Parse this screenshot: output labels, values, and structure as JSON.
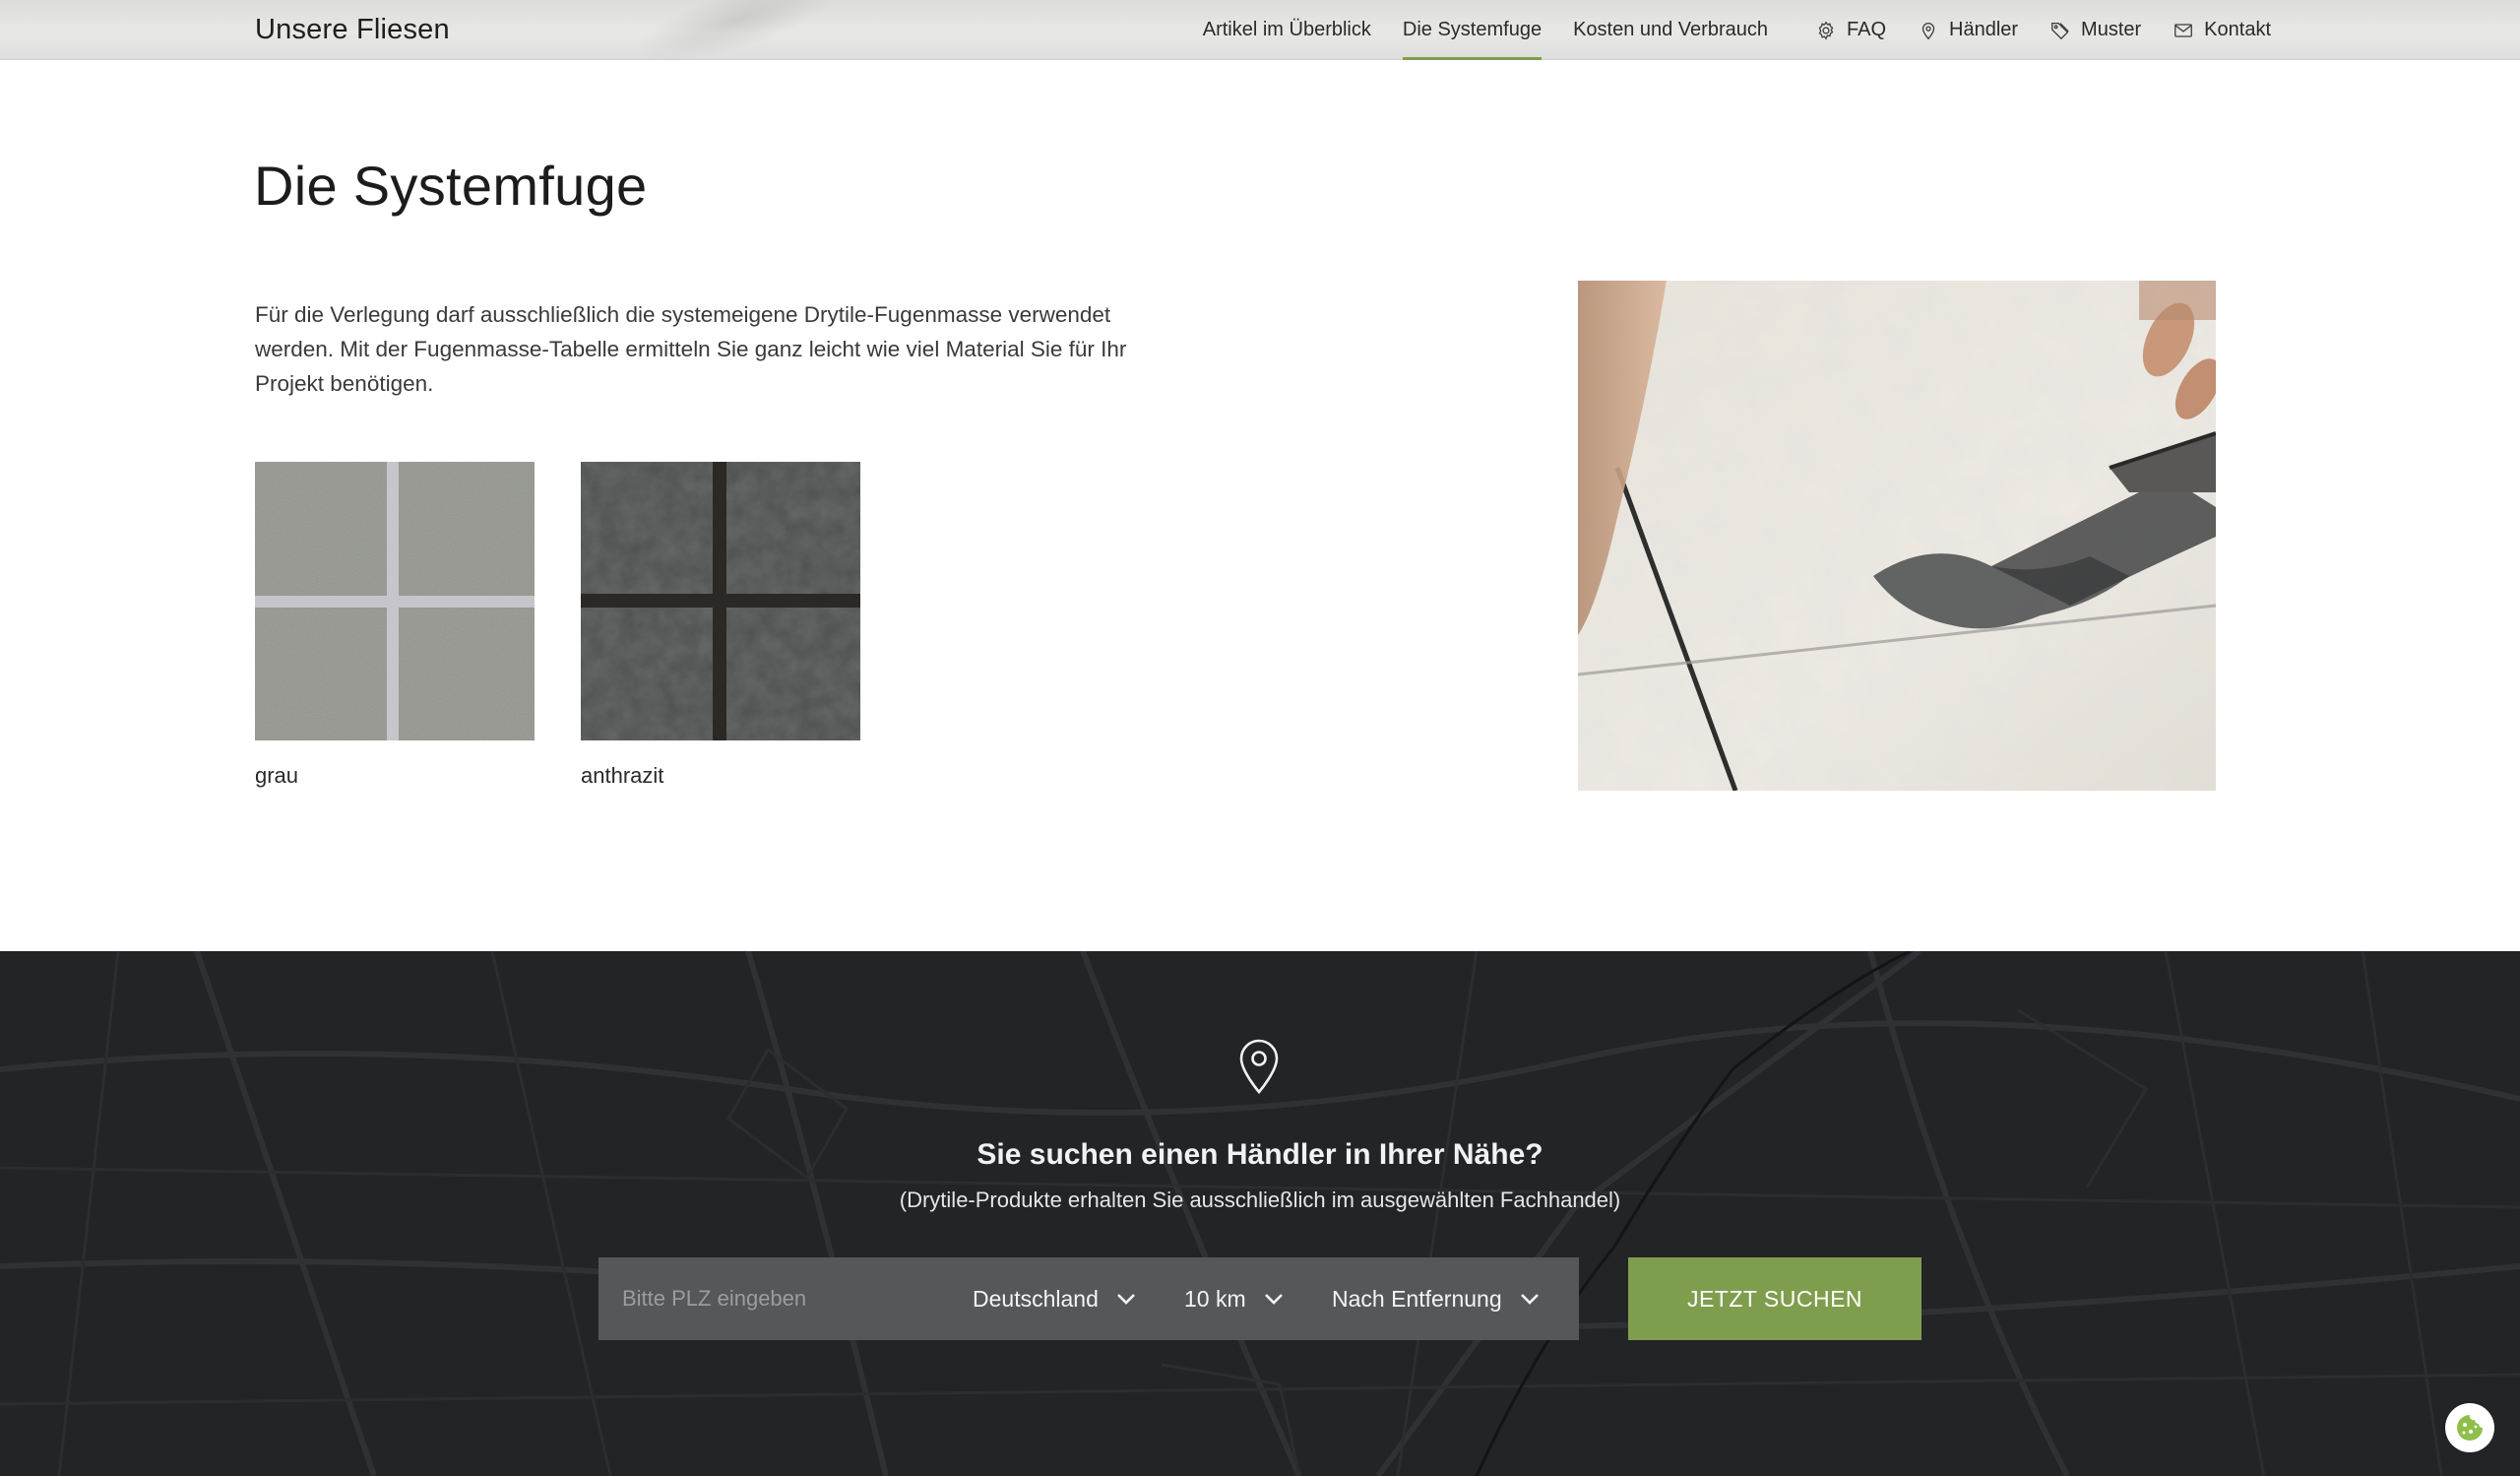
{
  "header": {
    "brand": "Unsere Fliesen",
    "nav": [
      {
        "label": "Artikel im Überblick",
        "icon": null,
        "active": false
      },
      {
        "label": "Die Systemfuge",
        "icon": null,
        "active": true
      },
      {
        "label": "Kosten und Verbrauch",
        "icon": null,
        "active": false
      },
      {
        "label": "FAQ",
        "icon": "gear-icon",
        "active": false
      },
      {
        "label": "Händler",
        "icon": "map-pin-icon",
        "active": false
      },
      {
        "label": "Muster",
        "icon": "tag-icon",
        "active": false
      },
      {
        "label": "Kontakt",
        "icon": "envelope-icon",
        "active": false
      }
    ]
  },
  "main": {
    "title": "Die Systemfuge",
    "intro": "Für die Verlegung darf ausschließlich die systemeigene Drytile-Fugenmasse verwendet werden. Mit der Fugenmasse-Tabelle ermitteln Sie ganz leicht wie viel Material Sie für Ihr Projekt benötigen.",
    "swatches": [
      {
        "label": "grau",
        "tile_color": "#8f918a",
        "grout_color": "#c9c8cf"
      },
      {
        "label": "anthrazit",
        "tile_color": "#4a4c4c",
        "grout_color": "#2a2826"
      }
    ]
  },
  "dealer": {
    "title": "Sie suchen einen Händler in Ihrer Nähe?",
    "subtitle": "(Drytile-Produkte erhalten Sie ausschließlich im ausgewählten Fachhandel)",
    "plz_placeholder": "Bitte PLZ eingeben",
    "country": "Deutschland",
    "radius": "10 km",
    "sort": "Nach Entfernung",
    "button": "JETZT SUCHEN"
  },
  "colors": {
    "accent": "#7f9e4d",
    "dark_bg": "#232426",
    "search_bg": "#55575b"
  }
}
